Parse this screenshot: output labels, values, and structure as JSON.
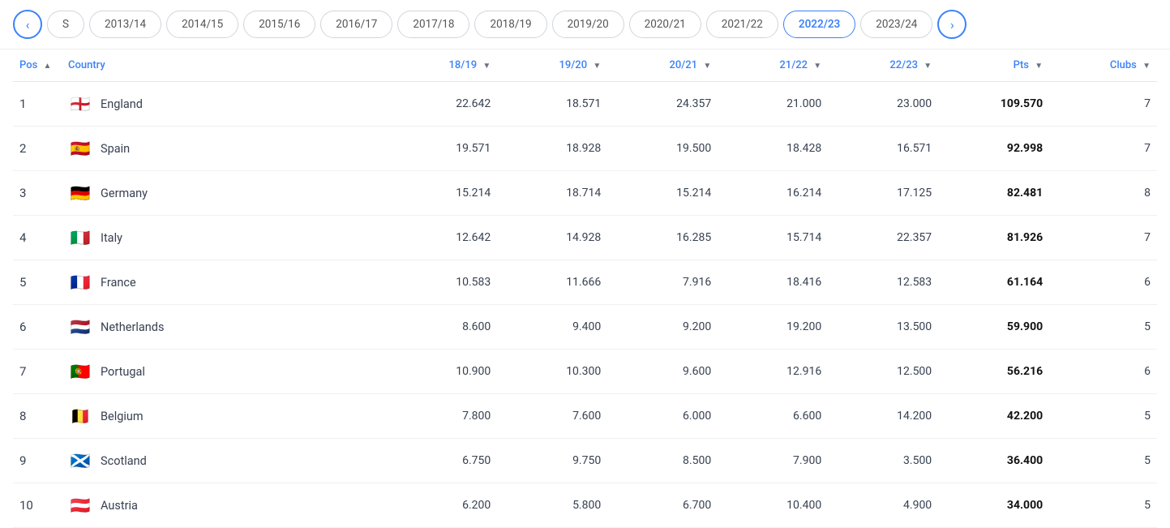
{
  "nav": {
    "prev_arrow": "‹",
    "next_arrow": "›",
    "seasons": [
      {
        "label": "S",
        "active": false
      },
      {
        "label": "2013/14",
        "active": false
      },
      {
        "label": "2014/15",
        "active": false
      },
      {
        "label": "2015/16",
        "active": false
      },
      {
        "label": "2016/17",
        "active": false
      },
      {
        "label": "2017/18",
        "active": false
      },
      {
        "label": "2018/19",
        "active": false
      },
      {
        "label": "2019/20",
        "active": false
      },
      {
        "label": "2020/21",
        "active": false
      },
      {
        "label": "2021/22",
        "active": false
      },
      {
        "label": "2022/23",
        "active": true
      },
      {
        "label": "2023/24",
        "active": false
      }
    ]
  },
  "table": {
    "headers": {
      "pos": "Pos",
      "country": "Country",
      "col1819": "18/19",
      "col1920": "19/20",
      "col2021": "20/21",
      "col2122": "21/22",
      "col2223": "22/23",
      "pts": "Pts",
      "clubs": "Clubs"
    },
    "rows": [
      {
        "pos": "1",
        "country": "England",
        "flag": "🏴󠁧󠁢󠁥󠁮󠁧󠁿",
        "flag_emoji": "🏴󠁧󠁢󠁥󠁮󠁧󠁿",
        "c1819": "22.642",
        "c1920": "18.571",
        "c2021": "24.357",
        "c2122": "21.000",
        "c2223": "23.000",
        "pts": "109.570",
        "clubs": "7"
      },
      {
        "pos": "2",
        "country": "Spain",
        "flag_emoji": "🇪🇸",
        "c1819": "19.571",
        "c1920": "18.928",
        "c2021": "19.500",
        "c2122": "18.428",
        "c2223": "16.571",
        "pts": "92.998",
        "clubs": "7"
      },
      {
        "pos": "3",
        "country": "Germany",
        "flag_emoji": "🇩🇪",
        "c1819": "15.214",
        "c1920": "18.714",
        "c2021": "15.214",
        "c2122": "16.214",
        "c2223": "17.125",
        "pts": "82.481",
        "clubs": "8"
      },
      {
        "pos": "4",
        "country": "Italy",
        "flag_emoji": "🇮🇹",
        "c1819": "12.642",
        "c1920": "14.928",
        "c2021": "16.285",
        "c2122": "15.714",
        "c2223": "22.357",
        "pts": "81.926",
        "clubs": "7"
      },
      {
        "pos": "5",
        "country": "France",
        "flag_emoji": "🇫🇷",
        "c1819": "10.583",
        "c1920": "11.666",
        "c2021": "7.916",
        "c2122": "18.416",
        "c2223": "12.583",
        "pts": "61.164",
        "clubs": "6"
      },
      {
        "pos": "6",
        "country": "Netherlands",
        "flag_emoji": "🇳🇱",
        "c1819": "8.600",
        "c1920": "9.400",
        "c2021": "9.200",
        "c2122": "19.200",
        "c2223": "13.500",
        "pts": "59.900",
        "clubs": "5"
      },
      {
        "pos": "7",
        "country": "Portugal",
        "flag_emoji": "🇵🇹",
        "c1819": "10.900",
        "c1920": "10.300",
        "c2021": "9.600",
        "c2122": "12.916",
        "c2223": "12.500",
        "pts": "56.216",
        "clubs": "6"
      },
      {
        "pos": "8",
        "country": "Belgium",
        "flag_emoji": "🇧🇪",
        "c1819": "7.800",
        "c1920": "7.600",
        "c2021": "6.000",
        "c2122": "6.600",
        "c2223": "14.200",
        "pts": "42.200",
        "clubs": "5"
      },
      {
        "pos": "9",
        "country": "Scotland",
        "flag_emoji": "🏴󠁧󠁢󠁳󠁣󠁴󠁿",
        "c1819": "6.750",
        "c1920": "9.750",
        "c2021": "8.500",
        "c2122": "7.900",
        "c2223": "3.500",
        "pts": "36.400",
        "clubs": "5"
      },
      {
        "pos": "10",
        "country": "Austria",
        "flag_emoji": "🇦🇹",
        "c1819": "6.200",
        "c1920": "5.800",
        "c2021": "6.700",
        "c2122": "10.400",
        "c2223": "4.900",
        "pts": "34.000",
        "clubs": "5"
      }
    ]
  }
}
